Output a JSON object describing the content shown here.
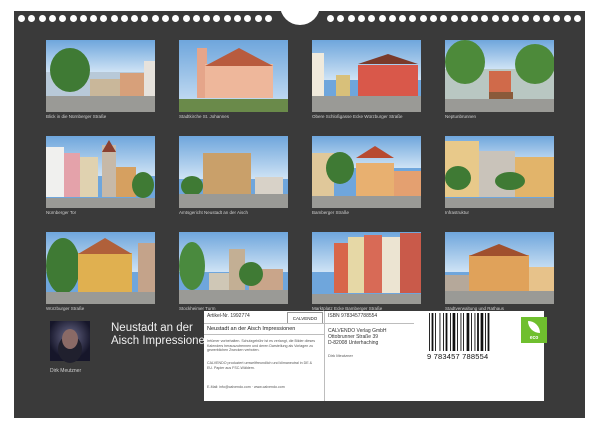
{
  "photos": [
    {
      "caption": "Blick in die Nürnberger Straße"
    },
    {
      "caption": "Stadtkirche St. Johannes"
    },
    {
      "caption": "Obere Schloßgasse Ecke Würzburger Straße"
    },
    {
      "caption": "Neptunbrunnen"
    },
    {
      "caption": "Nürnberger Tor"
    },
    {
      "caption": "Amtsgericht Neustadt an der Aisch"
    },
    {
      "caption": "Bamberger Straße"
    },
    {
      "caption": "Infrastruktur"
    },
    {
      "caption": "Würzburger Straße"
    },
    {
      "caption": "Stockheimer Turm"
    },
    {
      "caption": "Marktplatz Ecke Bamberger Straße"
    },
    {
      "caption": "Stadtverwaltung und Rathaus"
    }
  ],
  "author": {
    "name": "Dirk Meutzner"
  },
  "title": "Neustadt an der Aisch Impressionen",
  "info": {
    "article": "Artikel-Nr. 1992774",
    "logo": "CALVENDO",
    "subtitle": "Neustadt an der Aisch Impressionen",
    "isbn": "ISBN 9783457788554",
    "publisher_line1": "CALVENDO Verlag GmbH",
    "publisher_line2": "Ottobrunner Straße 39",
    "publisher_line3": "D-82008 Unterhaching",
    "author_small": "Dirk Meutzner",
    "legal1": "Irrtümer vorbehalten. Schutzgebühr ist es verlangt, die Bilder dieses Kalenders herauszutrennen und deren Darstellung als Vorlagen zu gewerblichen Zwecken verboten.",
    "legal2": "CALVENDO produziert umweltfreundlich und klimaneutral in DE & EU. Papier aus FSC-Wäldern.",
    "contact": "E-Mail: info@calvendo.com · www.calvendo.com"
  },
  "barcode": {
    "digits": "9 783457 788554"
  },
  "eco": {
    "label": "eco"
  }
}
